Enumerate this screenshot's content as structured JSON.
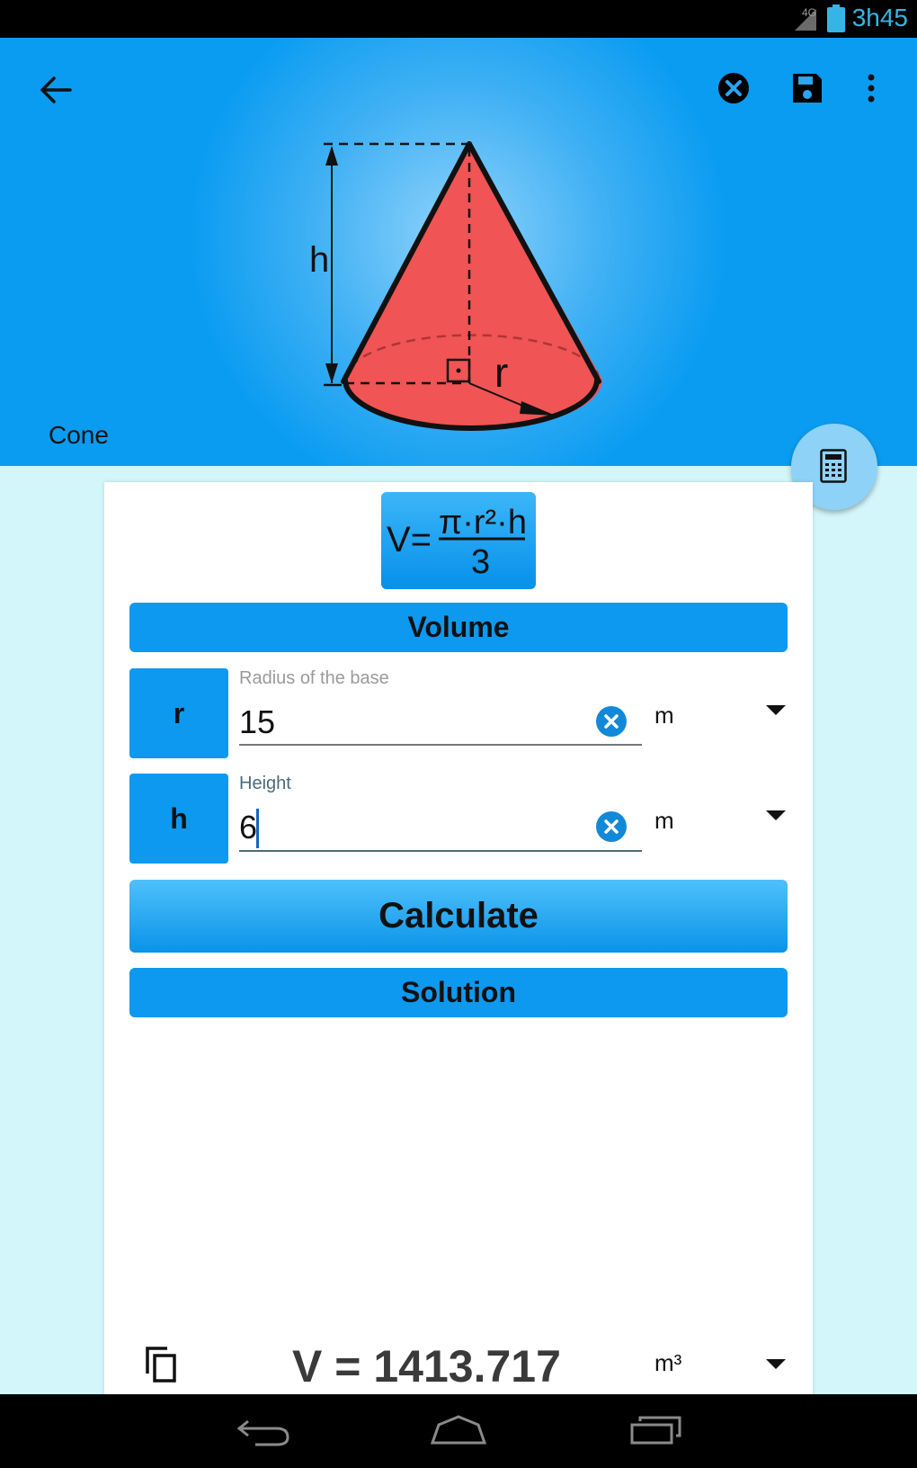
{
  "status_bar": {
    "network": "4G",
    "time": "3h45"
  },
  "header": {
    "shape_name": "Cone"
  },
  "figure": {
    "height_label": "h",
    "radius_label": "r"
  },
  "formula": {
    "lhs": "V=",
    "numerator": "π·r²·h",
    "denominator": "3"
  },
  "section": {
    "title": "Volume"
  },
  "fields": [
    {
      "symbol": "r",
      "label": "Radius of the base",
      "value": "15",
      "unit": "m"
    },
    {
      "symbol": "h",
      "label": "Height",
      "value": "6",
      "unit": "m"
    }
  ],
  "actions": {
    "calculate_label": "Calculate",
    "solution_label": "Solution"
  },
  "result": {
    "text": "V = 1413.717",
    "unit": "m³"
  },
  "colors": {
    "accent": "#0d99ef",
    "header": "#0a9cf1",
    "cone_fill": "#f05454",
    "background": "#d2f6fa"
  },
  "icons": [
    "back-arrow-icon",
    "clear-circle-icon",
    "save-icon",
    "more-vert-icon",
    "calculator-icon",
    "copy-icon",
    "dropdown-arrow-icon",
    "nav-back-icon",
    "nav-home-icon",
    "nav-recents-icon"
  ]
}
